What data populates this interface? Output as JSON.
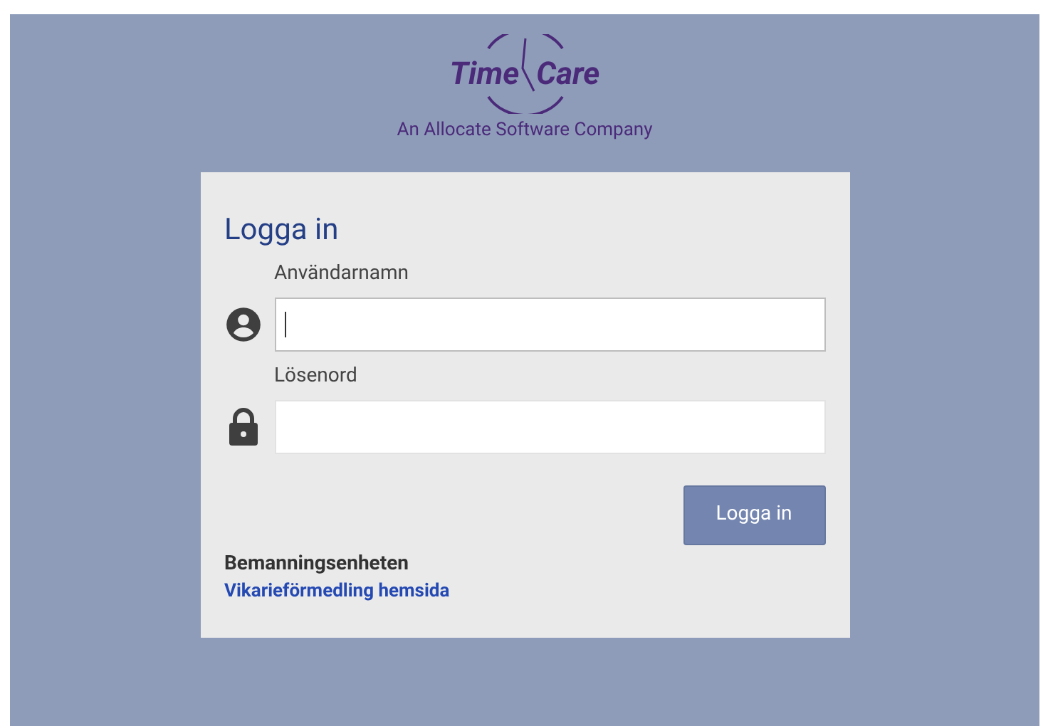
{
  "logo": {
    "word_1": "Time",
    "word_2": "Care",
    "tagline": "An Allocate Software Company"
  },
  "login": {
    "title": "Logga in",
    "fields": [
      {
        "kind": "user",
        "label": "Användarnamn",
        "focused": true
      },
      {
        "kind": "password",
        "label": "Lösenord",
        "focused": false
      }
    ],
    "submit": "Logga in",
    "unit": "Bemanningsenheten",
    "link": "Vikarieförmedling hemsida"
  }
}
